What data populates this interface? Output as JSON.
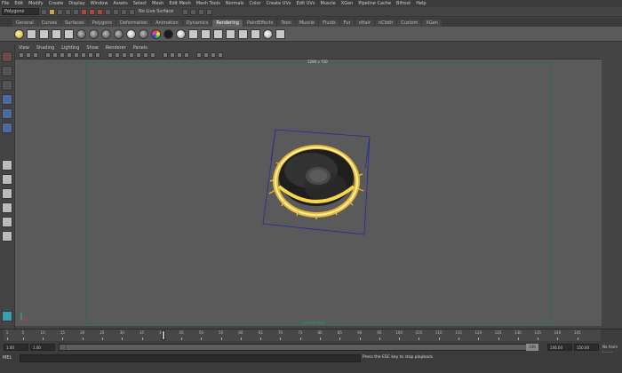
{
  "menubar": [
    "File",
    "Edit",
    "Modify",
    "Create",
    "Display",
    "Window",
    "Assets",
    "Select",
    "Mesh",
    "Edit Mesh",
    "Mesh Tools",
    "Normals",
    "Color",
    "Create UVs",
    "Edit UVs",
    "Muscle",
    "XGen",
    "Pipeline Cache",
    "Bifrost",
    "Help"
  ],
  "statusline": {
    "mode": "Polygons",
    "live_surface": "No Live Surface"
  },
  "shelf_tabs": [
    "General",
    "Curves",
    "Surfaces",
    "Polygons",
    "Deformation",
    "Animation",
    "Dynamics",
    "Rendering",
    "PaintEffects",
    "Toon",
    "Muscle",
    "Fluids",
    "Fur",
    "nHair",
    "nCloth",
    "Custom",
    "XGen"
  ],
  "active_shelf_tab": "Rendering",
  "panel_menu": [
    "View",
    "Shading",
    "Lighting",
    "Show",
    "Renderer",
    "Panels"
  ],
  "viewport": {
    "camera_top_label": "1280 x 720",
    "camera_bottom_label": "perspShape1"
  },
  "timeline": {
    "ticks": [
      "1",
      "5",
      "10",
      "15",
      "20",
      "25",
      "30",
      "35",
      "40",
      "45",
      "50",
      "55",
      "60",
      "65",
      "70",
      "75",
      "80",
      "85",
      "90",
      "95",
      "100",
      "105",
      "110",
      "115",
      "120",
      "125",
      "130",
      "135",
      "140",
      "145"
    ],
    "current_frame": "1"
  },
  "range": {
    "start": "1.00",
    "inner_start": "1.00",
    "slider_label": "1",
    "inner_end": "146",
    "end": "146.00",
    "end2": "150.00",
    "anim_layer": "No Anim Layer"
  },
  "cmd_label": "MEL",
  "help_text": "Press the ESC key to stop playback."
}
